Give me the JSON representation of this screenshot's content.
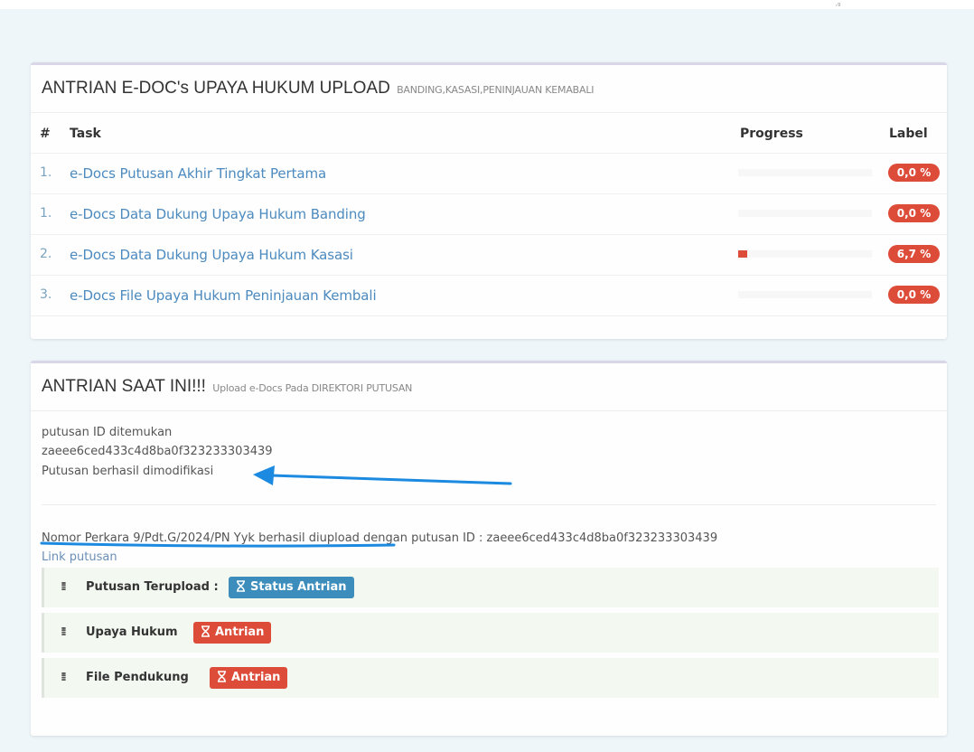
{
  "panel1": {
    "title": "ANTRIAN E-DOC's UPAYA HUKUM UPLOAD",
    "subtitle": "BANDING,KASASI,PENINJAUAN KEMABALI",
    "columns": {
      "num": "#",
      "task": "Task",
      "progress": "Progress",
      "label": "Label"
    },
    "rows": [
      {
        "num": "1.",
        "task": "e-Docs Putusan Akhir Tingkat Pertama",
        "progress": 0.0,
        "label": "0,0 %"
      },
      {
        "num": "1.",
        "task": "e-Docs Data Dukung Upaya Hukum Banding",
        "progress": 0.0,
        "label": "0,0 %"
      },
      {
        "num": "2.",
        "task": "e-Docs Data Dukung Upaya Hukum Kasasi",
        "progress": 6.7,
        "label": "6,7 %"
      },
      {
        "num": "3.",
        "task": "e-Docs File Upaya Hukum Peninjauan Kembali",
        "progress": 0.0,
        "label": "0,0 %"
      }
    ]
  },
  "panel2": {
    "title": "ANTRIAN SAAT INI!!!",
    "subtitle": "Upload e-Docs Pada DIREKTORI PUTUSAN",
    "log": [
      "putusan ID ditemukan",
      "zaeee6ced433c4d8ba0f323233303439",
      "Putusan berhasil dimodifikasi"
    ],
    "upload_message": "Nomor Perkara 9/Pdt.G/2024/PN Yyk berhasil diupload dengan putusan ID : zaeee6ced433c4d8ba0f323233303439",
    "link_text": "Link putusan",
    "items": [
      {
        "label": "Putusan Terupload :",
        "status": "Status Antrian",
        "status_color": "#3c8dbc",
        "icon": "hourglass-icon"
      },
      {
        "label": "Upaya Hukum",
        "status": "Antrian",
        "status_color": "#dd4b39",
        "icon": "hourglass-icon"
      },
      {
        "label": "File Pendukung",
        "status": "Antrian",
        "status_color": "#dd4b39",
        "icon": "hourglass-icon"
      }
    ]
  },
  "colors": {
    "accent_red": "#dd4b39",
    "accent_blue": "#3c8dbc",
    "link_blue": "#4c8abf",
    "annotation_blue": "#1c8ae0"
  }
}
